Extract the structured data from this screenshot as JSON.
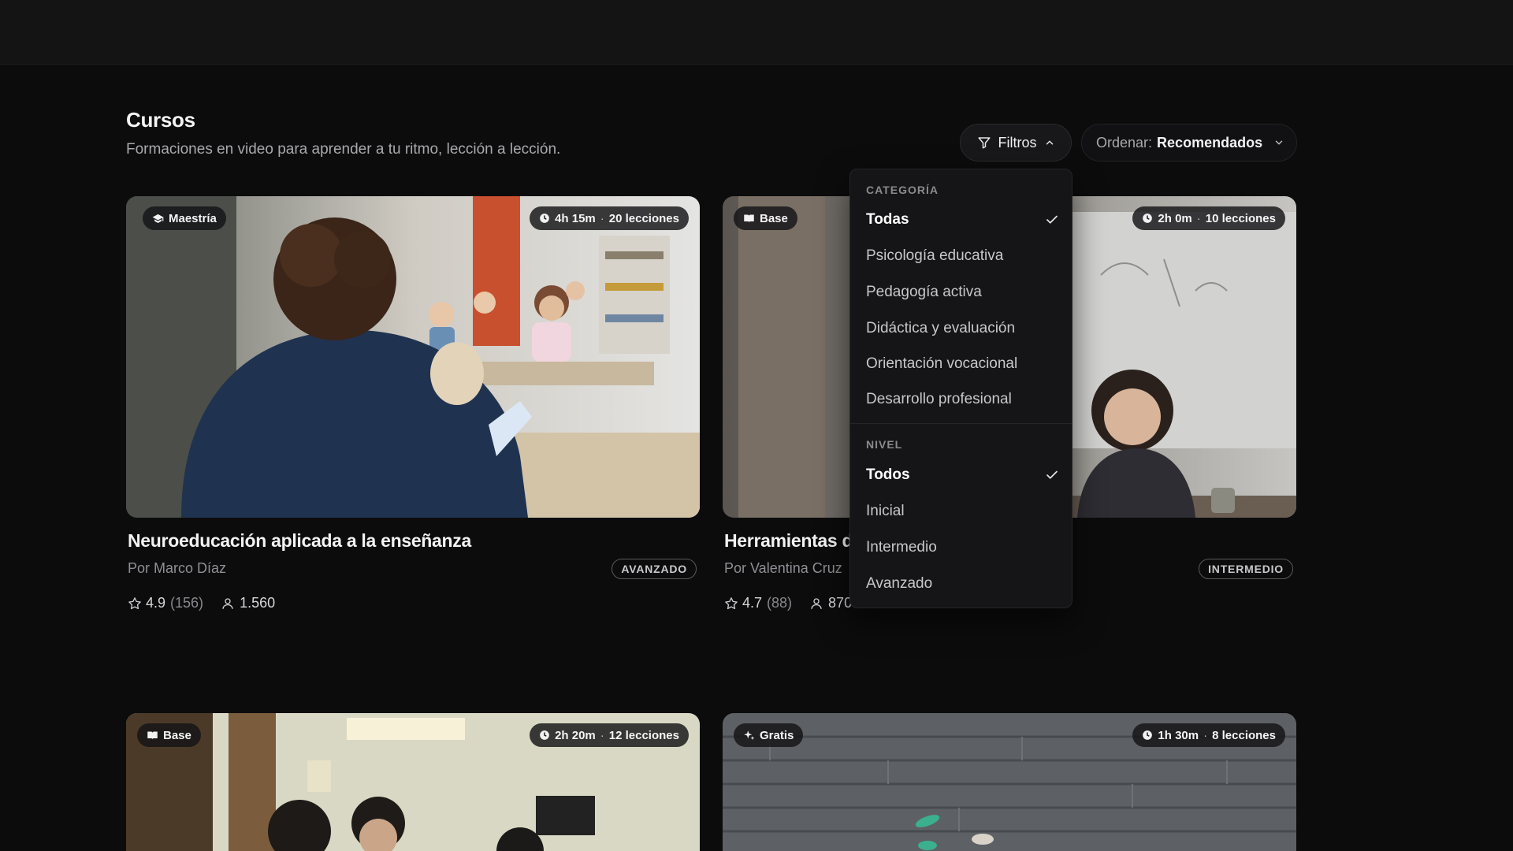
{
  "header": {
    "title": "Cursos",
    "subtitle": "Formaciones en video para aprender a tu ritmo, lección a lección."
  },
  "toolbar": {
    "filters_label": "Filtros",
    "sort_prefix": "Ordenar:",
    "sort_value": "Recomendados"
  },
  "filters_menu": {
    "category_title": "CATEGORÍA",
    "categories": [
      "Todas",
      "Psicología educativa",
      "Pedagogía activa",
      "Didáctica y evaluación",
      "Orientación vocacional",
      "Desarrollo profesional"
    ],
    "selected_category": "Todas",
    "level_title": "NIVEL",
    "levels": [
      "Todos",
      "Inicial",
      "Intermedio",
      "Avanzado"
    ],
    "selected_level": "Todos"
  },
  "courses": [
    {
      "type_badge": "Maestría",
      "type_icon": "graduation-cap-icon",
      "duration": "4h 15m",
      "lessons": "20 lecciones",
      "title": "Neuroeducación aplicada a la enseñanza",
      "author": "Por Marco Díaz",
      "level": "AVANZADO",
      "rating": "4.9",
      "reviews": "(156)",
      "students": "1.560"
    },
    {
      "type_badge": "Base",
      "type_icon": "book-icon",
      "duration": "2h 0m",
      "lessons": "10 lecciones",
      "title": "Herramientas d",
      "author": "Por Valentina Cruz",
      "level": "INTERMEDIO",
      "rating": "4.7",
      "reviews": "(88)",
      "students": "870"
    },
    {
      "type_badge": "Base",
      "type_icon": "book-icon",
      "duration": "2h 20m",
      "lessons": "12 lecciones"
    },
    {
      "type_badge": "Gratis",
      "type_icon": "sparkle-icon",
      "duration": "1h 30m",
      "lessons": "8 lecciones"
    }
  ],
  "colors": {
    "background": "#0c0c0d",
    "topbar": "#141415",
    "menu_background": "#151517",
    "text_primary": "#f3f3f3",
    "text_muted": "#8f8f94"
  }
}
